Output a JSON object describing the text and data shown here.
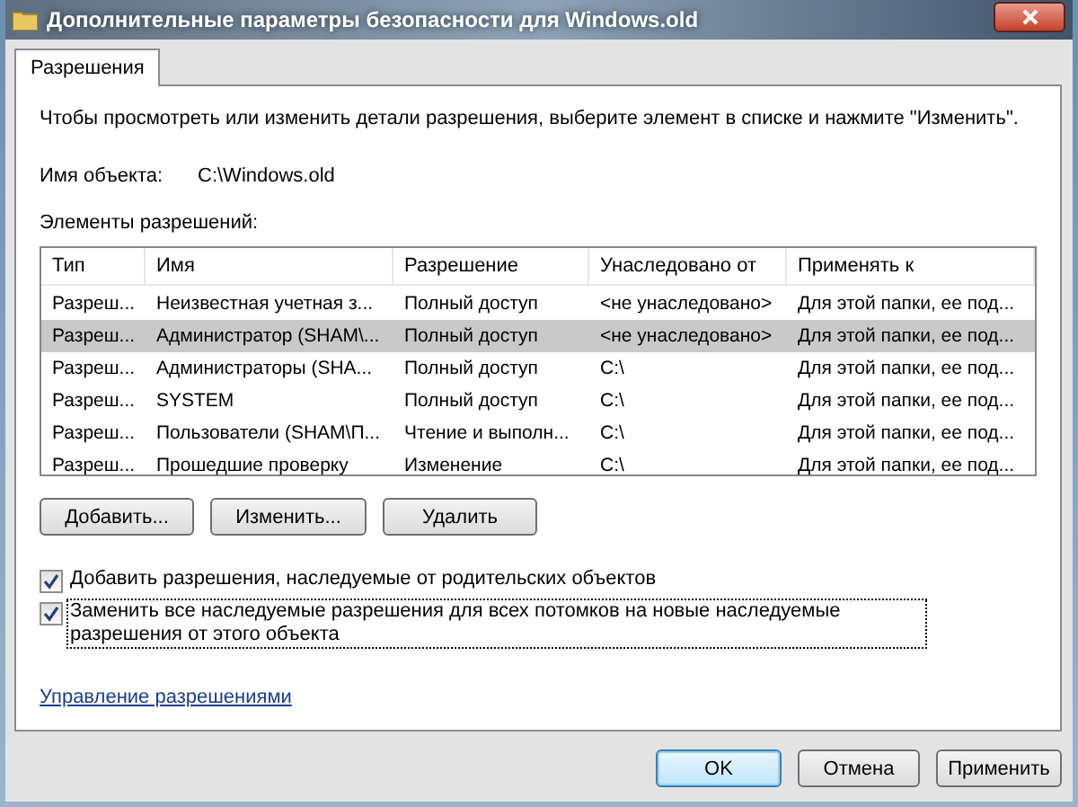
{
  "window": {
    "title": "Дополнительные параметры безопасности для Windows.old"
  },
  "tabs": [
    {
      "label": "Разрешения",
      "selected": true
    }
  ],
  "instruction": "Чтобы просмотреть или изменить детали разрешения, выберите элемент в списке и нажмите \"Изменить\".",
  "object_name": {
    "label": "Имя объекта:",
    "value": "C:\\Windows.old"
  },
  "entries_label": "Элементы разрешений:",
  "table": {
    "columns": [
      "Тип",
      "Имя",
      "Разрешение",
      "Унаследовано от",
      "Применять к"
    ],
    "rows": [
      {
        "cells": [
          "Разреш...",
          "Неизвестная учетная з...",
          "Полный доступ",
          "<не унаследовано>",
          "Для этой папки, ее под..."
        ],
        "selected": false
      },
      {
        "cells": [
          "Разреш...",
          "Администратор (SHAM\\...",
          "Полный доступ",
          "<не унаследовано>",
          "Для этой папки, ее под..."
        ],
        "selected": true
      },
      {
        "cells": [
          "Разреш...",
          "Администраторы (SHA...",
          "Полный доступ",
          "C:\\",
          "Для этой папки, ее под..."
        ],
        "selected": false
      },
      {
        "cells": [
          "Разреш...",
          "SYSTEM",
          "Полный доступ",
          "C:\\",
          "Для этой папки, ее под..."
        ],
        "selected": false
      },
      {
        "cells": [
          "Разреш...",
          "Пользователи (SHAM\\П...",
          "Чтение и выполн...",
          "C:\\",
          "Для этой папки, ее под..."
        ],
        "selected": false
      },
      {
        "cells": [
          "Разреш...",
          "Прошедшие проверку",
          "Изменение",
          "C:\\",
          "Для этой папки, ее под..."
        ],
        "selected": false
      }
    ]
  },
  "list_buttons": [
    "Добавить...",
    "Изменить...",
    "Удалить"
  ],
  "checkboxes": [
    {
      "label": "Добавить разрешения, наследуемые от родительских объектов",
      "checked": true,
      "focused": false
    },
    {
      "label": "Заменить все наследуемые разрешения для всех потомков на новые наследуемые разрешения от этого объекта",
      "checked": true,
      "focused": true
    }
  ],
  "link": "Управление разрешениями",
  "dialog_buttons": [
    {
      "label": "OK",
      "default": true
    },
    {
      "label": "Отмена",
      "default": false
    },
    {
      "label": "Применить",
      "default": false
    }
  ]
}
